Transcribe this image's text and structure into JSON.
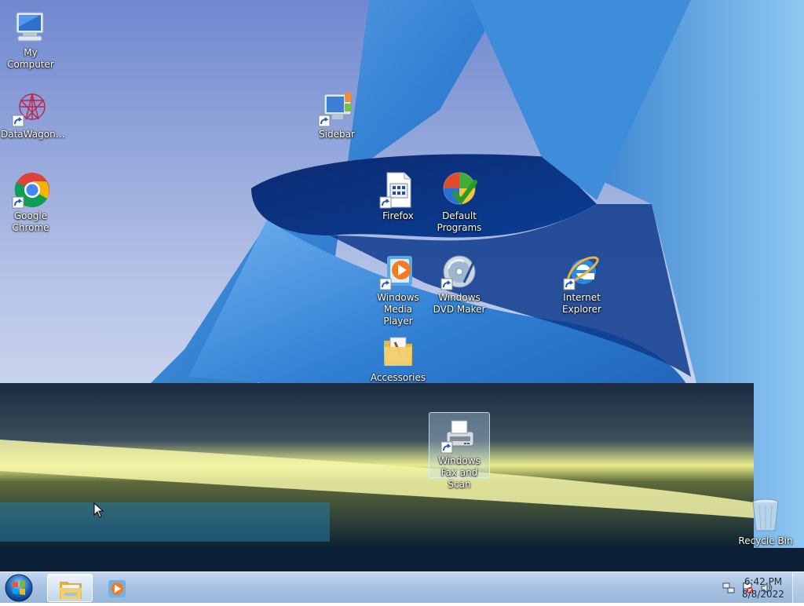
{
  "desktop": {
    "icons": {
      "my_computer": {
        "label": "My Computer",
        "icon": "computer-icon"
      },
      "datawagon": {
        "label": "DataWagon…",
        "icon": "datawagon-icon"
      },
      "chrome": {
        "label": "Google Chrome",
        "icon": "chrome-icon"
      },
      "sidebar": {
        "label": "Sidebar",
        "icon": "sidebar-icon"
      },
      "firefox": {
        "label": "Firefox",
        "icon": "document-icon"
      },
      "default_programs": {
        "label": "Default Programs",
        "icon": "default-programs-icon"
      },
      "wmp": {
        "label": "Windows Media Player",
        "icon": "media-player-icon"
      },
      "dvd_maker": {
        "label": "Windows DVD Maker",
        "icon": "dvd-maker-icon"
      },
      "ie": {
        "label": "Internet Explorer",
        "icon": "internet-explorer-icon"
      },
      "accessories": {
        "label": "Accessories",
        "icon": "folder-icon"
      },
      "fax_scan": {
        "label": "Windows Fax and Scan",
        "icon": "fax-scanner-icon",
        "selected": true
      },
      "recycle_bin": {
        "label": "Recycle Bin",
        "icon": "recycle-bin-icon"
      }
    }
  },
  "taskbar": {
    "clock_time": "6:42 PM",
    "clock_date": "8/8/2022"
  },
  "colors": {
    "taskbar": "#a9c4e2",
    "sky": "#b9c6e6",
    "building": "#2f7fd3"
  }
}
